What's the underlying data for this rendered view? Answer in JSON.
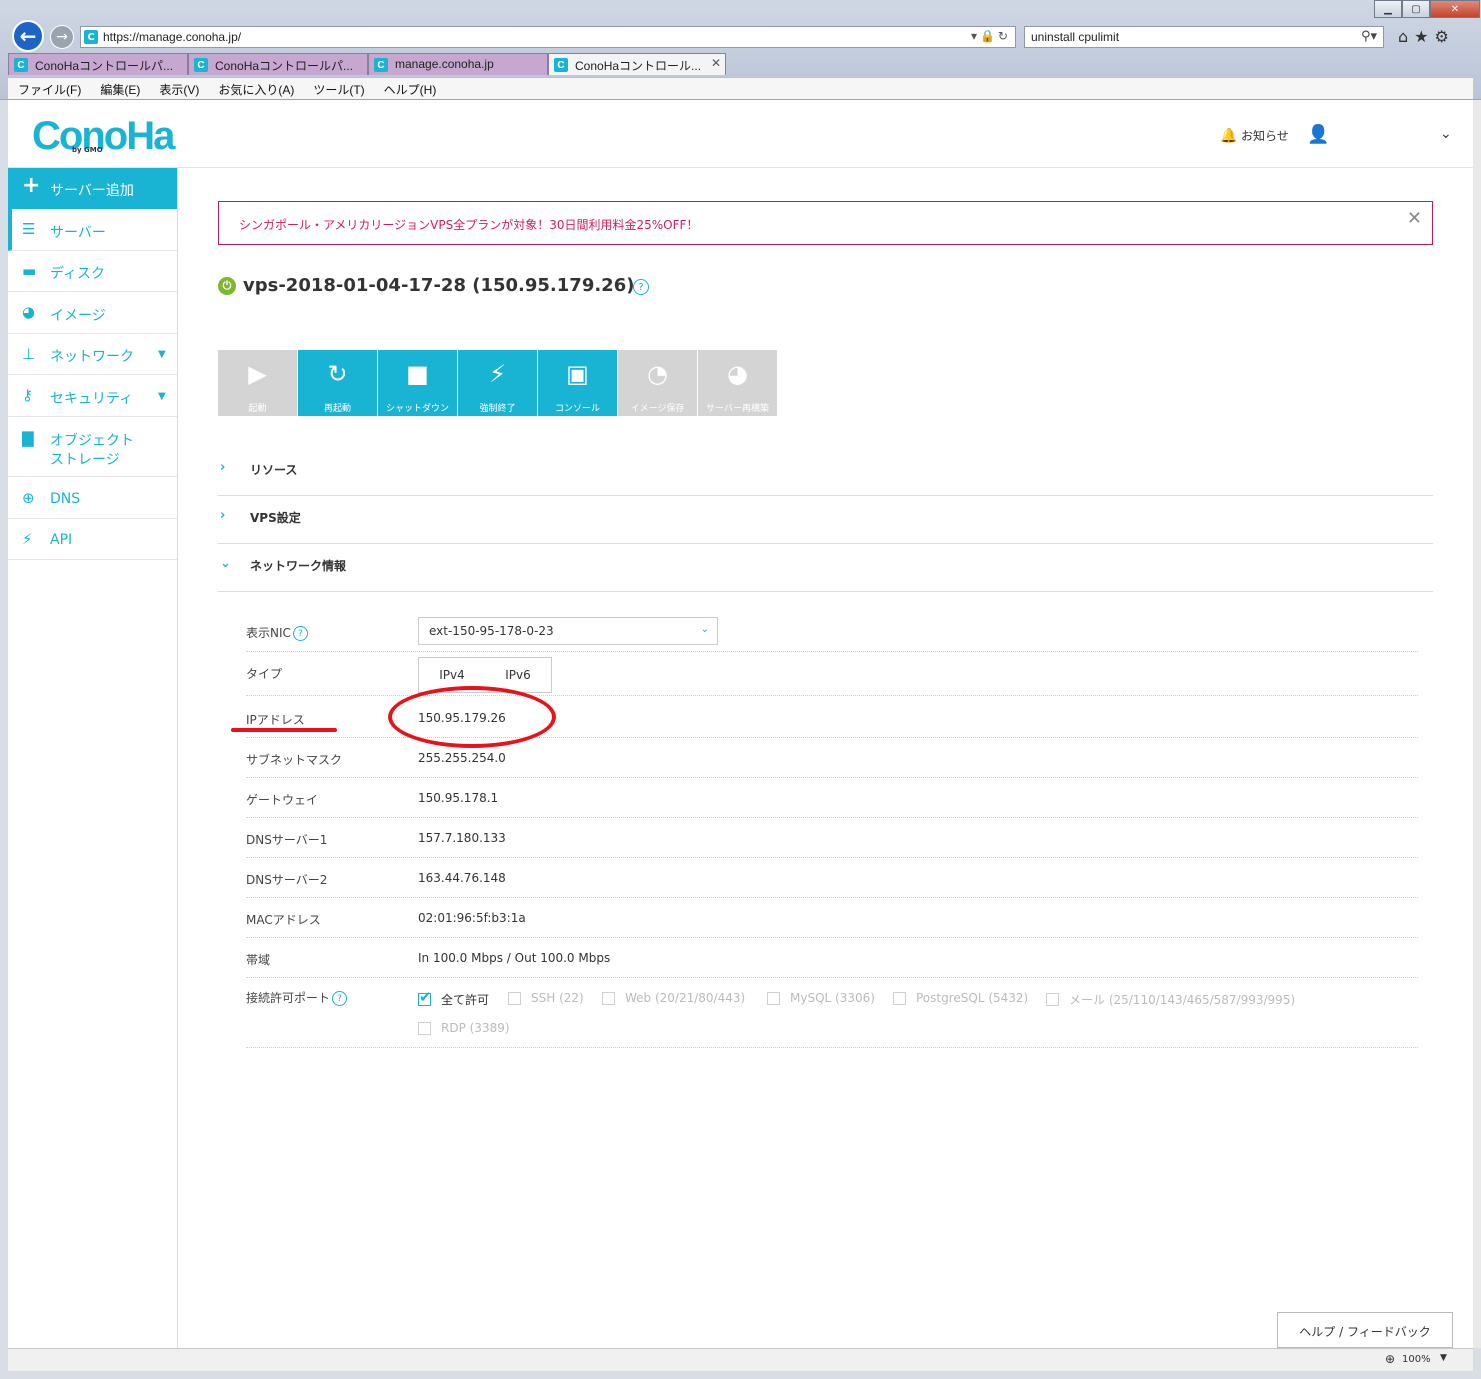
{
  "browser": {
    "url": "https://manage.conoha.jp/",
    "search_value": "uninstall cpulimit",
    "tabs": [
      {
        "label": "ConoHaコントロールパ..."
      },
      {
        "label": "ConoHaコントロールパ..."
      },
      {
        "label": "manage.conoha.jp"
      },
      {
        "label": "ConoHaコントロール..."
      }
    ],
    "menu": [
      "ファイル(F)",
      "編集(E)",
      "表示(V)",
      "お気に入り(A)",
      "ツール(T)",
      "ヘルプ(H)"
    ],
    "zoom": "100%"
  },
  "header": {
    "logo": "ConoHa",
    "logo_sub": "by GMO",
    "notifications_label": "お知らせ"
  },
  "sidebar": {
    "add_server": "サーバー追加",
    "items": [
      {
        "label": "サーバー",
        "icon": "server-icon"
      },
      {
        "label": "ディスク",
        "icon": "disk-icon"
      },
      {
        "label": "イメージ",
        "icon": "globe-icon"
      },
      {
        "label": "ネットワーク",
        "icon": "network-icon"
      },
      {
        "label": "セキュリティ",
        "icon": "key-icon"
      },
      {
        "label": "オブジェクト",
        "label2": "ストレージ",
        "icon": "folder-icon"
      },
      {
        "label": "DNS",
        "icon": "dns-globe-icon"
      },
      {
        "label": "API",
        "icon": "api-icon"
      }
    ]
  },
  "promo": {
    "text": "シンガポール・アメリカリージョンVPS全プランが対象！30日間利用料金25%OFF！"
  },
  "server": {
    "title": "vps-2018-01-04-17-28 (150.95.179.26)",
    "status": "running"
  },
  "actions": [
    {
      "label": "起動",
      "enabled": false
    },
    {
      "label": "再起動",
      "enabled": true
    },
    {
      "label": "シャットダウン",
      "enabled": true
    },
    {
      "label": "強制終了",
      "enabled": true
    },
    {
      "label": "コンソール",
      "enabled": true
    },
    {
      "label": "イメージ保存",
      "enabled": false
    },
    {
      "label": "サーバー再構築",
      "enabled": false
    }
  ],
  "sections": {
    "resources": "リソース",
    "vps_settings": "VPS設定",
    "network_info": "ネットワーク情報"
  },
  "network": {
    "nic_label": "表示NIC",
    "nic_value": "ext-150-95-178-0-23",
    "type_label": "タイプ",
    "type_options": [
      "IPv4",
      "IPv6"
    ],
    "ip_label": "IPアドレス",
    "ip_value": "150.95.179.26",
    "subnet_label": "サブネットマスク",
    "subnet_value": "255.255.254.0",
    "gateway_label": "ゲートウェイ",
    "gateway_value": "150.95.178.1",
    "dns1_label": "DNSサーバー1",
    "dns1_value": "157.7.180.133",
    "dns2_label": "DNSサーバー2",
    "dns2_value": "163.44.76.148",
    "mac_label": "MACアドレス",
    "mac_value": "02:01:96:5f:b3:1a",
    "bandwidth_label": "帯域",
    "bandwidth_value": "In 100.0 Mbps / Out 100.0 Mbps",
    "ports_label": "接続許可ポート",
    "ports": [
      {
        "label": "全て許可",
        "checked": true
      },
      {
        "label": "SSH (22)",
        "checked": false
      },
      {
        "label": "Web (20/21/80/443)",
        "checked": false
      },
      {
        "label": "MySQL (3306)",
        "checked": false
      },
      {
        "label": "PostgreSQL (5432)",
        "checked": false
      },
      {
        "label": "メール (25/110/143/465/587/993/995)",
        "checked": false
      },
      {
        "label": "RDP (3389)",
        "checked": false
      }
    ]
  },
  "footer": {
    "help_feedback": "ヘルプ / フィードバック"
  },
  "colors": {
    "accent": "#19b4d4",
    "promo": "#d81b60",
    "annotation": "#e8121a",
    "status_on": "#7cb82f"
  }
}
